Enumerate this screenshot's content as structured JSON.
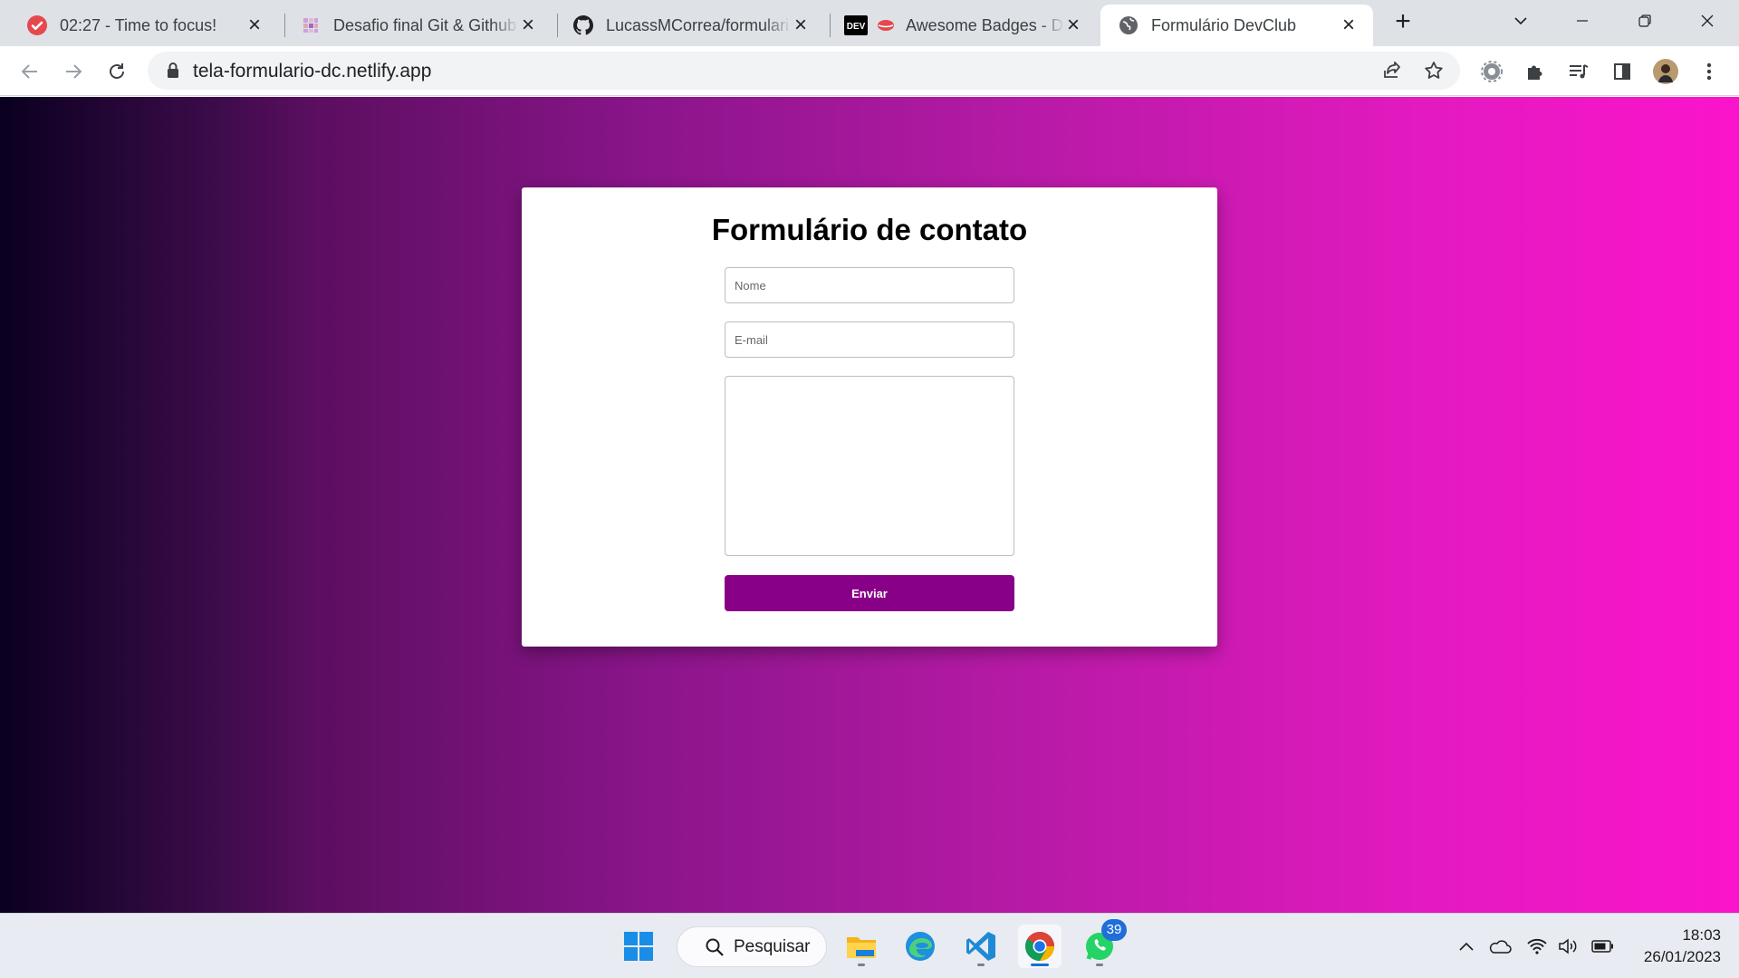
{
  "browser": {
    "tabs": [
      {
        "title": "02:27 - Time to focus!",
        "favicon": "check-circle-icon"
      },
      {
        "title": "Desafio final Git & Github",
        "favicon": "pixel-grid-icon"
      },
      {
        "title": "LucassMCorrea/formulari",
        "favicon": "github-icon"
      },
      {
        "title": "Awesome Badges - DE",
        "favicon": "lips-icon"
      },
      {
        "title": "Formulário DevClub",
        "favicon": "globe-icon",
        "active": true
      }
    ],
    "url": "tela-formulario-dc.netlify.app"
  },
  "form": {
    "title": "Formulário de contato",
    "name_placeholder": "Nome",
    "email_placeholder": "E-mail",
    "message_value": "",
    "submit_label": "Enviar",
    "button_color": "#880088"
  },
  "taskbar": {
    "search_label": "Pesquisar",
    "whatsapp_badge": "39",
    "time": "18:03",
    "date": "26/01/2023"
  },
  "colors": {
    "gradient_start": "#0a0020",
    "gradient_end": "#fb14cb"
  }
}
